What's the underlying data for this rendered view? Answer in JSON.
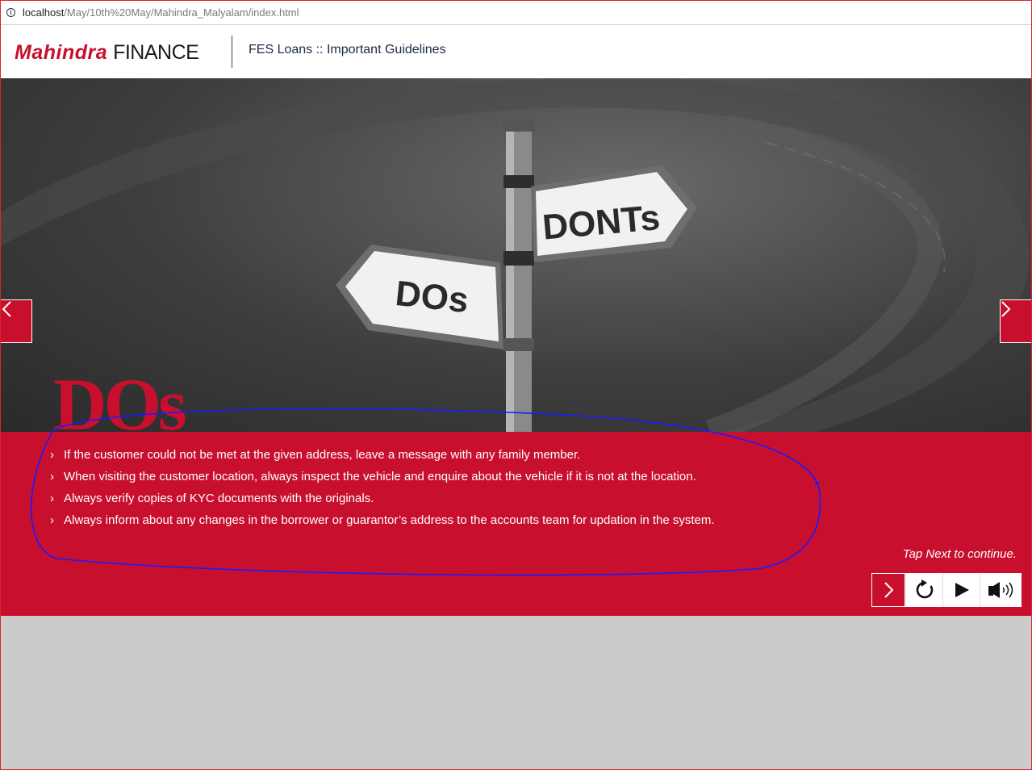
{
  "browser": {
    "url_host": "localhost",
    "url_path": "/May/10th%20May/Mahindra_Malyalam/index.html"
  },
  "header": {
    "logo_brand": "Mahindra",
    "logo_word": "FINANCE",
    "title": "FES Loans :: Important Guidelines"
  },
  "hero": {
    "sign_dos": "DOs",
    "sign_donts": "DONTs",
    "section_heading": "DOs"
  },
  "guidelines": [
    "If the customer could not be met at the given address, leave a message with any family member.",
    "When visiting the customer location, always inspect the vehicle and enquire about the vehicle if it is not at the location.",
    "Always verify copies of KYC documents with the originals.",
    "Always inform about any changes in the borrower or guarantor’s address to the accounts team for updation in the system."
  ],
  "footer": {
    "tap_hint": "Tap Next to continue."
  },
  "icons": {
    "prev": "chevron-left-icon",
    "next": "chevron-right-icon",
    "replay": "replay-icon",
    "play": "play-icon",
    "audio": "speaker-icon"
  },
  "colors": {
    "brand_red": "#c8102e",
    "annotation_blue": "#1a1aff"
  }
}
